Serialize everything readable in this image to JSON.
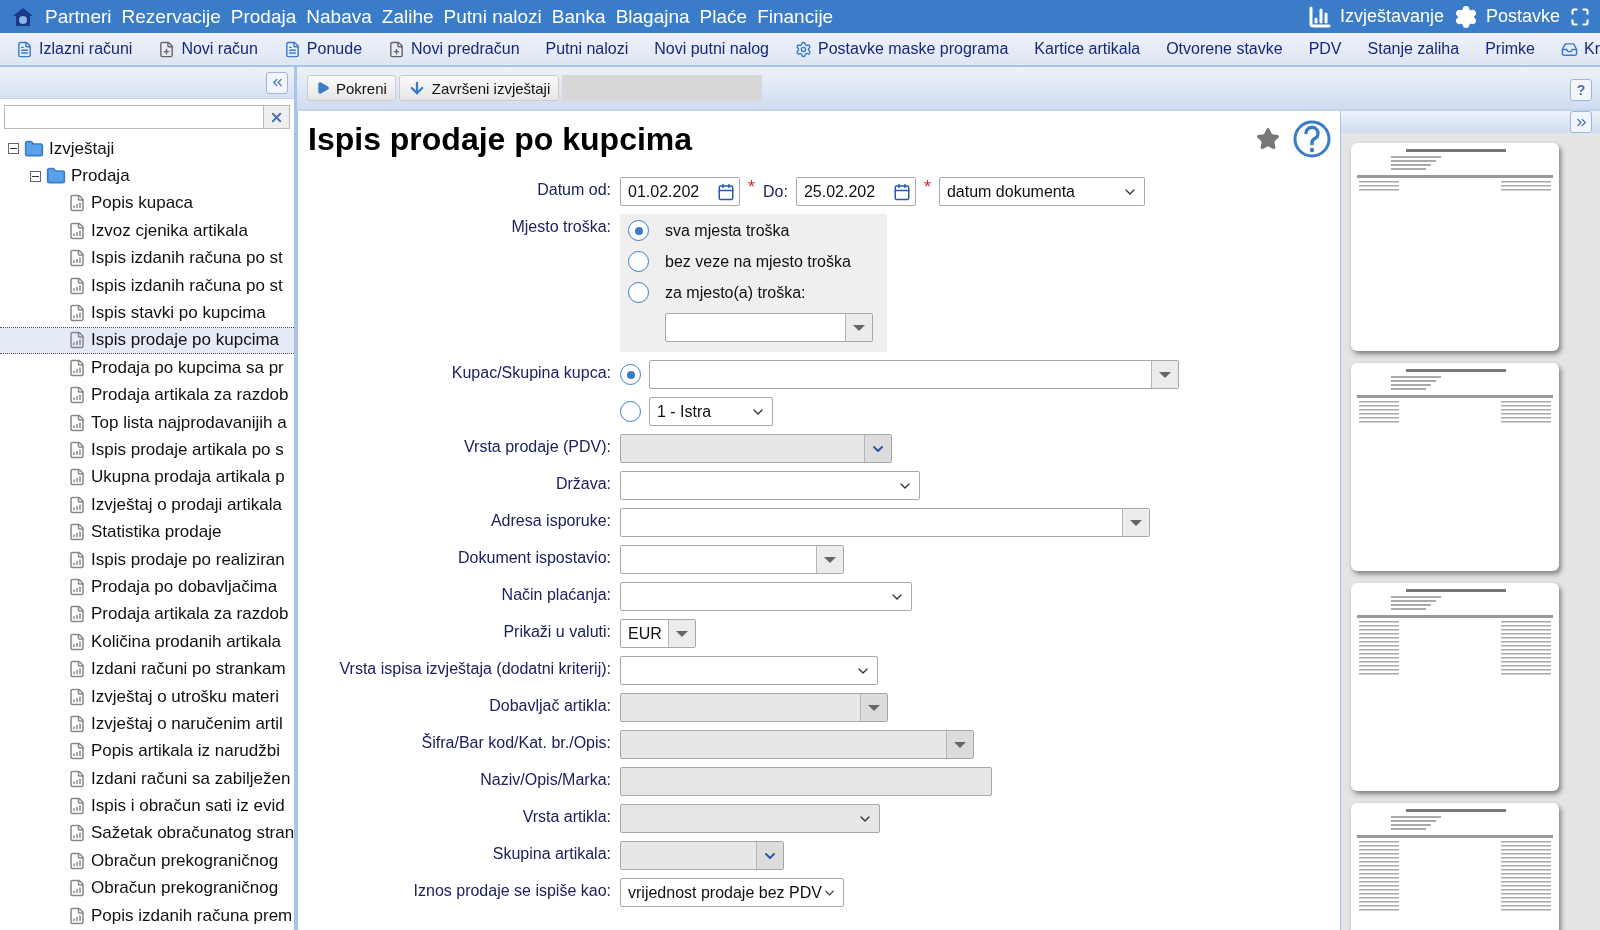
{
  "menu": {
    "items": [
      "Partneri",
      "Rezervacije",
      "Prodaja",
      "Nabava",
      "Zalihe",
      "Putni nalozi",
      "Banka",
      "Blagajna",
      "Plaće",
      "Financije"
    ],
    "right": [
      {
        "kind": "chart",
        "label": "Izvještavanje"
      },
      {
        "kind": "settings",
        "label": "Postavke"
      },
      {
        "kind": "fullscreen"
      }
    ]
  },
  "toolbar": [
    {
      "kind": "document",
      "label": "Izlazni računi"
    },
    {
      "kind": "new",
      "label": "Novi račun"
    },
    {
      "kind": "document",
      "label": "Ponude"
    },
    {
      "kind": "new",
      "label": "Novi predračun"
    },
    {
      "kind": "plain",
      "label": "Putni nalozi"
    },
    {
      "kind": "plain",
      "label": "Novi putni nalog"
    },
    {
      "kind": "settings",
      "label": "Postavke maske programa"
    },
    {
      "kind": "plain",
      "label": "Kartice artikala"
    },
    {
      "kind": "plain",
      "label": "Otvorene stavke"
    },
    {
      "kind": "plain",
      "label": "PDV"
    },
    {
      "kind": "plain",
      "label": "Stanje zaliha"
    },
    {
      "kind": "plain",
      "label": "Primke"
    },
    {
      "kind": "tray",
      "label": "Kr"
    }
  ],
  "help_button": "?",
  "sidebar": {
    "tree": [
      {
        "label": "Izvještaji",
        "expanded": true,
        "selected": false,
        "children": [
          {
            "label": "Prodaja",
            "expanded": true,
            "selected": false,
            "children": [
              {
                "label": "Popis kupaca",
                "selected": false
              },
              {
                "label": "Izvoz cjenika artikala",
                "selected": false
              },
              {
                "label": "Ispis izdanih računa po st",
                "selected": false
              },
              {
                "label": "Ispis izdanih računa po st",
                "selected": false
              },
              {
                "label": "Ispis stavki po kupcima",
                "selected": false
              },
              {
                "label": "Ispis prodaje po kupcima",
                "selected": true
              },
              {
                "label": "Prodaja po kupcima sa pr",
                "selected": false
              },
              {
                "label": "Prodaja artikala za razdob",
                "selected": false
              },
              {
                "label": "Top lista najprodavanijih a",
                "selected": false
              },
              {
                "label": "Ispis prodaje artikala po s",
                "selected": false
              },
              {
                "label": "Ukupna prodaja artikala p",
                "selected": false
              },
              {
                "label": "Izvještaj o prodaji artikala",
                "selected": false
              },
              {
                "label": "Statistika prodaje",
                "selected": false
              },
              {
                "label": "Ispis prodaje po realiziran",
                "selected": false
              },
              {
                "label": "Prodaja po dobavljačima",
                "selected": false
              },
              {
                "label": "Prodaja artikala za razdob",
                "selected": false
              },
              {
                "label": "Količina prodanih artikala",
                "selected": false
              },
              {
                "label": "Izdani računi po strankam",
                "selected": false
              },
              {
                "label": "Izvještaj o utrošku materi",
                "selected": false
              },
              {
                "label": "Izvještaj o naručenim artil",
                "selected": false
              },
              {
                "label": "Popis artikala iz narudžbi",
                "selected": false
              },
              {
                "label": "Izdani računi sa zabilježen",
                "selected": false
              },
              {
                "label": "Ispis i obračun sati iz evid",
                "selected": false
              },
              {
                "label": "Sažetak obračunatog stran",
                "selected": false
              },
              {
                "label": "Obračun prekograničnog",
                "selected": false
              },
              {
                "label": "Obračun prekograničnog",
                "selected": false
              },
              {
                "label": "Popis izdanih računa prem",
                "selected": false
              }
            ]
          }
        ]
      }
    ]
  },
  "actions": [
    {
      "kind": "run",
      "label": "Pokreni"
    },
    {
      "kind": "finished",
      "label": "Završeni izvještaji"
    }
  ],
  "title": "Ispis prodaje po kupcima",
  "form": [
    {
      "kind": "dates",
      "label": "Datum od:",
      "from": "01.02.202",
      "to_label": "Do:",
      "to": "25.02.202",
      "required_mark": "*",
      "basis": {
        "kind": "select",
        "value": "datum dokumenta",
        "disabled": false
      }
    },
    {
      "kind": "radios",
      "label": "Mjesto troška:",
      "options": [
        {
          "label": "sva mjesta troška",
          "selected": true
        },
        {
          "label": "bez veze na mjesto troška",
          "selected": false
        },
        {
          "label": "za mjesto(a) troška:",
          "selected": false
        }
      ],
      "field": {
        "kind": "combo",
        "disabled": false
      }
    },
    {
      "kind": "choice",
      "label": "Kupac/Skupina kupca:",
      "options": [
        {
          "selected": true,
          "field": {
            "kind": "combo",
            "disabled": false
          }
        },
        {
          "selected": false,
          "field": {
            "kind": "select",
            "value": "1 - Istra",
            "disabled": false
          }
        }
      ]
    },
    {
      "kind": "field",
      "label": "Vrsta prodaje (PDV):",
      "field": {
        "kind": "dropdown",
        "disabled": true
      }
    },
    {
      "kind": "field",
      "label": "Država:",
      "field": {
        "kind": "select",
        "disabled": false
      }
    },
    {
      "kind": "field",
      "label": "Adresa isporuke:",
      "field": {
        "kind": "combo",
        "disabled": false
      }
    },
    {
      "kind": "field",
      "label": "Dokument ispostavio:",
      "field": {
        "kind": "combo",
        "disabled": false
      }
    },
    {
      "kind": "field",
      "label": "Način plaćanja:",
      "field": {
        "kind": "select",
        "disabled": false
      }
    },
    {
      "kind": "field",
      "label": "Prikaži u valuti:",
      "field": {
        "kind": "combo",
        "value": "EUR",
        "disabled": false
      }
    },
    {
      "kind": "field",
      "label": "Vrsta ispisa izvještaja (dodatni kriterij):",
      "field": {
        "kind": "select",
        "disabled": false
      }
    },
    {
      "kind": "field",
      "label": "Dobavljač artikla:",
      "field": {
        "kind": "combo",
        "disabled": true
      }
    },
    {
      "kind": "field",
      "label": "Šifra/Bar kod/Kat. br./Opis:",
      "field": {
        "kind": "combo",
        "disabled": true
      }
    },
    {
      "kind": "field",
      "label": "Naziv/Opis/Marka:",
      "field": {
        "kind": "text",
        "disabled": true
      }
    },
    {
      "kind": "field",
      "label": "Vrsta artikla:",
      "field": {
        "kind": "select",
        "disabled": true
      }
    },
    {
      "kind": "field",
      "label": "Skupina artikala:",
      "field": {
        "kind": "dropdown",
        "disabled": true
      }
    },
    {
      "kind": "field",
      "label": "Iznos prodaje se ispiše kao:",
      "field": {
        "kind": "select",
        "value": "vrijednost prodaje bez PDV",
        "disabled": false
      }
    }
  ]
}
